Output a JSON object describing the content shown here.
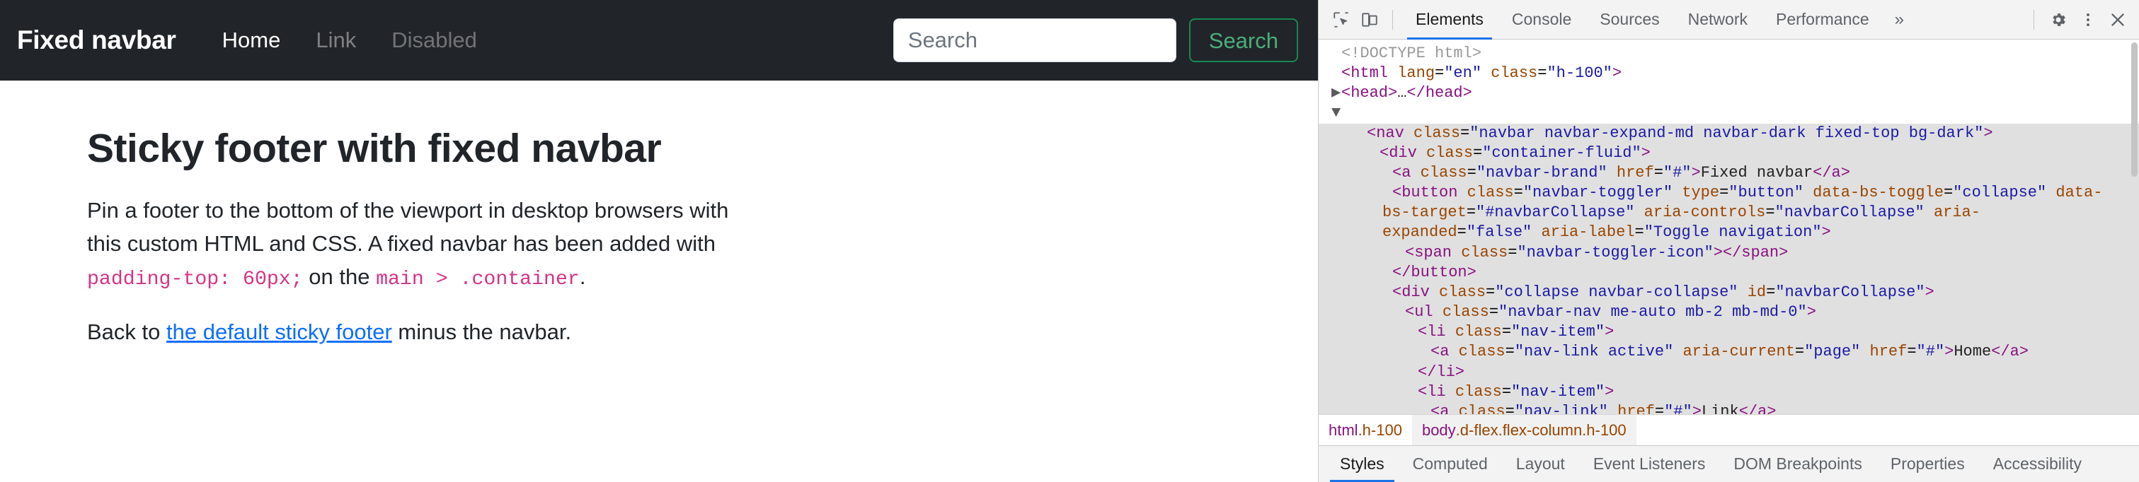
{
  "page": {
    "navbar": {
      "brand": "Fixed navbar",
      "links": [
        {
          "label": "Home",
          "state": "active"
        },
        {
          "label": "Link",
          "state": "muted"
        },
        {
          "label": "Disabled",
          "state": "disabled"
        }
      ],
      "search": {
        "placeholder": "Search",
        "value": "",
        "button_label": "Search"
      },
      "bg_color": "#212529",
      "accent_color": "#198754"
    },
    "main": {
      "title": "Sticky footer with fixed navbar",
      "lead_part1": "Pin a footer to the bottom of the viewport in desktop browsers with this custom HTML and CSS. A fixed navbar has been added with ",
      "lead_code1": "padding-top: 60px;",
      "lead_part2": " on the ",
      "lead_code2": "main > .container",
      "lead_part3": ".",
      "back_part1": "Back to ",
      "back_link": "the default sticky footer",
      "back_part2": " minus the navbar.",
      "code_color": "#d63384",
      "link_color": "#0d6efd"
    }
  },
  "devtools": {
    "toolbar": {
      "inspect_icon": "inspect-element-icon",
      "device_icon": "device-toolbar-icon",
      "tabs": [
        {
          "label": "Elements",
          "active": true
        },
        {
          "label": "Console",
          "active": false
        },
        {
          "label": "Sources",
          "active": false
        },
        {
          "label": "Network",
          "active": false
        },
        {
          "label": "Performance",
          "active": false
        }
      ],
      "more_label": "»",
      "settings_icon": "gear-icon",
      "kebab_icon": "more-vertical-icon",
      "close_icon": "close-icon"
    },
    "dom_lines": [
      {
        "indent": 0,
        "selected": false,
        "triangle": "",
        "html": "<span class=\"doctype\">&lt;!DOCTYPE html&gt;</span>"
      },
      {
        "indent": 0,
        "selected": false,
        "triangle": "",
        "html": "<span class=\"punc\">&lt;html</span> <span class=\"attr\">lang</span>=<span class=\"val\">\"en\"</span> <span class=\"attr\">class</span>=<span class=\"val\">\"h-100\"</span><span class=\"punc\">&gt;</span>"
      },
      {
        "indent": 0,
        "selected": false,
        "triangle": "▶",
        "html": "<span class=\"punc\">&lt;head&gt;</span><span class=\"txt\">…</span><span class=\"punc\">&lt;/head&gt;</span>"
      },
      {
        "indent": 0,
        "selected": false,
        "triangle": "▼",
        "html": ""
      },
      {
        "indent": 2,
        "selected": true,
        "triangle": "",
        "html": "<span class=\"punc\">&lt;nav</span> <span class=\"attr\">class</span>=<span class=\"val\">\"navbar navbar-expand-md navbar-dark fixed-top bg-dark\"</span><span class=\"punc\">&gt;</span>"
      },
      {
        "indent": 3,
        "selected": true,
        "triangle": "",
        "html": "<span class=\"punc\">&lt;div</span> <span class=\"attr\">class</span>=<span class=\"val\">\"container-fluid\"</span><span class=\"punc\">&gt;</span>"
      },
      {
        "indent": 4,
        "selected": true,
        "triangle": "",
        "html": "<span class=\"punc\">&lt;a</span> <span class=\"attr\">class</span>=<span class=\"val\">\"navbar-brand\"</span> <span class=\"attr\">href</span>=<span class=\"val\">\"#\"</span><span class=\"punc\">&gt;</span><span class=\"txt\">Fixed navbar</span><span class=\"punc\">&lt;/a&gt;</span>"
      },
      {
        "indent": 4,
        "selected": true,
        "triangle": "",
        "html": "<span class=\"punc\">&lt;button</span> <span class=\"attr\">class</span>=<span class=\"val\">\"navbar-toggler\"</span> <span class=\"attr\">type</span>=<span class=\"val\">\"button\"</span> <span class=\"attr\">data-bs-toggle</span>=<span class=\"val\">\"collapse\"</span> <span class=\"attr\">data-bs-target</span>=<span class=\"val\">\"#navbarCollapse\"</span> <span class=\"attr\">aria-controls</span>=<span class=\"val\">\"navbarCollapse\"</span> <span class=\"attr\">aria-expanded</span>=<span class=\"val\">\"false\"</span> <span class=\"attr\">aria-label</span>=<span class=\"val\">\"Toggle navigation\"</span><span class=\"punc\">&gt;</span>"
      },
      {
        "indent": 5,
        "selected": true,
        "triangle": "",
        "html": "<span class=\"punc\">&lt;span</span> <span class=\"attr\">class</span>=<span class=\"val\">\"navbar-toggler-icon\"</span><span class=\"punc\">&gt;&lt;/span&gt;</span>"
      },
      {
        "indent": 4,
        "selected": true,
        "triangle": "",
        "html": "<span class=\"punc\">&lt;/button&gt;</span>"
      },
      {
        "indent": 4,
        "selected": true,
        "triangle": "",
        "html": "<span class=\"punc\">&lt;div</span> <span class=\"attr\">class</span>=<span class=\"val\">\"collapse navbar-collapse\"</span> <span class=\"attr\">id</span>=<span class=\"val\">\"navbarCollapse\"</span><span class=\"punc\">&gt;</span>"
      },
      {
        "indent": 5,
        "selected": true,
        "triangle": "",
        "html": "<span class=\"punc\">&lt;ul</span> <span class=\"attr\">class</span>=<span class=\"val\">\"navbar-nav me-auto mb-2 mb-md-0\"</span><span class=\"punc\">&gt;</span>"
      },
      {
        "indent": 6,
        "selected": true,
        "triangle": "",
        "html": "<span class=\"punc\">&lt;li</span> <span class=\"attr\">class</span>=<span class=\"val\">\"nav-item\"</span><span class=\"punc\">&gt;</span>"
      },
      {
        "indent": 7,
        "selected": true,
        "triangle": "",
        "html": "<span class=\"punc\">&lt;a</span> <span class=\"attr\">class</span>=<span class=\"val\">\"nav-link active\"</span> <span class=\"attr\">aria-current</span>=<span class=\"val\">\"page\"</span> <span class=\"attr\">href</span>=<span class=\"val\">\"#\"</span><span class=\"punc\">&gt;</span><span class=\"txt\">Home</span><span class=\"punc\">&lt;/a&gt;</span>"
      },
      {
        "indent": 6,
        "selected": true,
        "triangle": "",
        "html": "<span class=\"punc\">&lt;/li&gt;</span>"
      },
      {
        "indent": 6,
        "selected": true,
        "triangle": "",
        "html": "<span class=\"punc\">&lt;li</span> <span class=\"attr\">class</span>=<span class=\"val\">\"nav-item\"</span><span class=\"punc\">&gt;</span>"
      },
      {
        "indent": 7,
        "selected": true,
        "triangle": "",
        "html": "<span class=\"punc\">&lt;a</span> <span class=\"attr\">class</span>=<span class=\"val\">\"nav-link\"</span> <span class=\"attr\">href</span>=<span class=\"val\">\"#\"</span><span class=\"punc\">&gt;</span><span class=\"txt\">Link</span><span class=\"punc\">&lt;/a&gt;</span>"
      }
    ],
    "breadcrumb": [
      {
        "tag": "html",
        "cls": ".h-100",
        "selected": false
      },
      {
        "tag": "body",
        "cls": ".d-flex.flex-column.h-100",
        "selected": true
      }
    ],
    "bottom_tabs": [
      {
        "label": "Styles",
        "active": true
      },
      {
        "label": "Computed",
        "active": false
      },
      {
        "label": "Layout",
        "active": false
      },
      {
        "label": "Event Listeners",
        "active": false
      },
      {
        "label": "DOM Breakpoints",
        "active": false
      },
      {
        "label": "Properties",
        "active": false
      },
      {
        "label": "Accessibility",
        "active": false
      }
    ]
  }
}
